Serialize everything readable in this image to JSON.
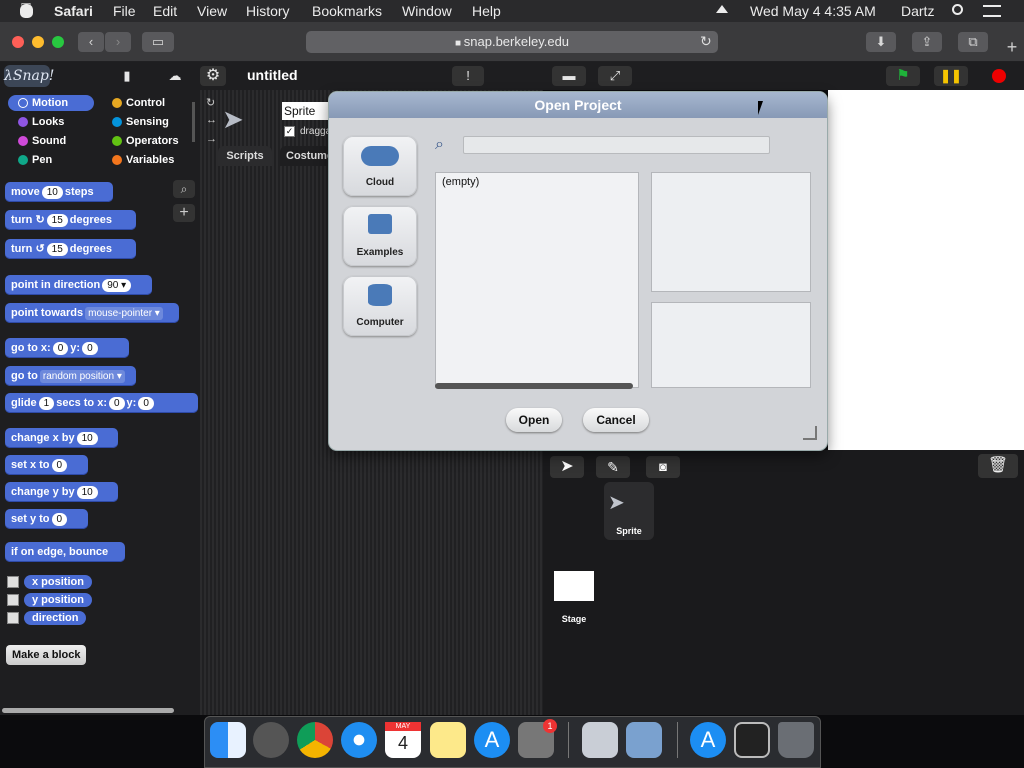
{
  "menubar": {
    "apple": "",
    "app": "Safari",
    "items": [
      "File",
      "Edit",
      "View",
      "History",
      "Bookmarks",
      "Window",
      "Help"
    ],
    "clock": "Wed May 4  4:35 AM",
    "user": "Dartz"
  },
  "browser": {
    "url": "snap.berkeley.edu"
  },
  "snap": {
    "logo": "λSnap!",
    "project_title": "untitled",
    "categories": [
      "Motion",
      "Control",
      "Looks",
      "Sensing",
      "Sound",
      "Operators",
      "Pen",
      "Variables"
    ],
    "category_colors": {
      "motion": "#4a6cd4",
      "looks": "#8f56e3",
      "sound": "#cf4ad9",
      "pen": "#0fa889",
      "control": "#e6a822",
      "sensing": "#0494dc",
      "operators": "#62c213",
      "variables": "#f3761d"
    },
    "blocks": {
      "move": {
        "a": "move",
        "v": "10",
        "b": "steps"
      },
      "turn_cw": {
        "a": "turn ↻",
        "v": "15",
        "b": "degrees"
      },
      "turn_ccw": {
        "a": "turn ↺",
        "v": "15",
        "b": "degrees"
      },
      "point_dir": {
        "a": "point in direction",
        "v": "90 ▾"
      },
      "point_towards": {
        "a": "point towards",
        "v": "mouse-pointer ▾"
      },
      "goto_xy": {
        "a": "go to x:",
        "x": "0",
        "b": "y:",
        "y": "0"
      },
      "goto": {
        "a": "go to",
        "v": "random position ▾"
      },
      "glide": {
        "a": "glide",
        "s": "1",
        "b": "secs to x:",
        "x": "0",
        "c": "y:",
        "y": "0"
      },
      "change_x": {
        "a": "change x by",
        "v": "10"
      },
      "set_x": {
        "a": "set x to",
        "v": "0"
      },
      "change_y": {
        "a": "change y by",
        "v": "10"
      },
      "set_y": {
        "a": "set y to",
        "v": "0"
      },
      "bounce": {
        "a": "if on edge, bounce"
      },
      "x_position": "x position",
      "y_position": "y position",
      "direction": "direction"
    },
    "make_block": "Make a block",
    "sprite_name": "Sprite",
    "draggable": "dragga",
    "tabs": {
      "scripts": "Scripts",
      "costumes": "Costume"
    },
    "corral": {
      "sprite": "Sprite",
      "stage": "Stage"
    }
  },
  "dialog": {
    "title": "Open Project",
    "sources": [
      "Cloud",
      "Examples",
      "Computer"
    ],
    "search_value": "",
    "list_items": [
      "(empty)"
    ],
    "open_label": "Open",
    "cancel_label": "Cancel"
  },
  "dock": {
    "calendar_month": "MAY",
    "calendar_day": "4",
    "notification_badge": "1"
  }
}
